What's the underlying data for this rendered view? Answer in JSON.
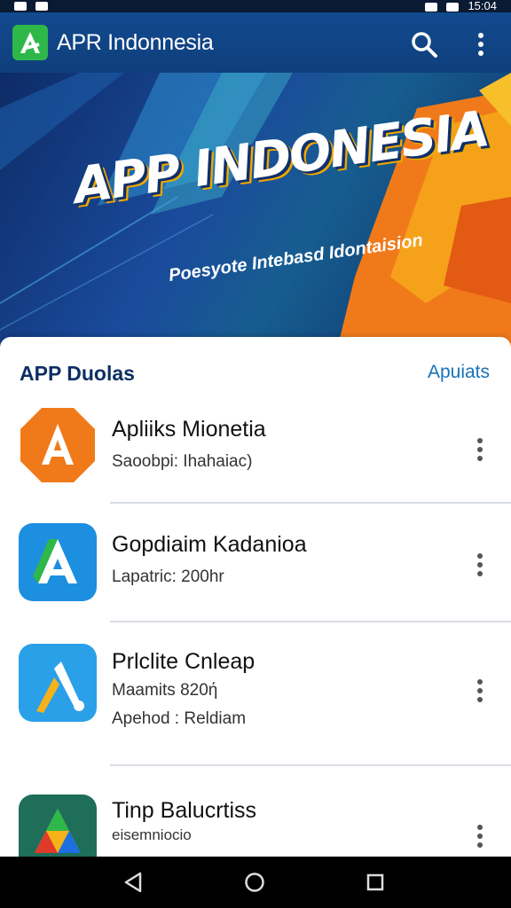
{
  "status_bar": {
    "time": "15:04"
  },
  "app_bar": {
    "title": "APR Indonnesia",
    "search_icon": "search-icon",
    "more_icon": "more-vertical-icon"
  },
  "banner": {
    "title": "APP INDONESIA",
    "subtitle": "Poesyote Intebasd Idontaision"
  },
  "section": {
    "title": "APP Duolas",
    "link": "Apuiats"
  },
  "apps": [
    {
      "name": "Apliiks Mionetia",
      "meta1": "Saoobpi:  Ihahaiac)",
      "meta2": "",
      "icon": "orange-a-icon"
    },
    {
      "name": "Gopdiaim Kadanioa",
      "meta1": "Lapatric: 200hr",
      "meta2": "",
      "icon": "blue-a-icon"
    },
    {
      "name": "Prlclite Cnleap",
      "meta1": "Maamits 820ή",
      "meta2": "Apehod : Reldiam",
      "icon": "light-blue-lambda-icon"
    },
    {
      "name": "Tinp Balucrtiss",
      "meta1": "eisemniocio",
      "meta2": "",
      "icon": "multicolor-a-icon"
    }
  ],
  "colors": {
    "app_bar": "#124a8f",
    "accent_link": "#1a73b8",
    "section_title": "#0d2f63"
  }
}
